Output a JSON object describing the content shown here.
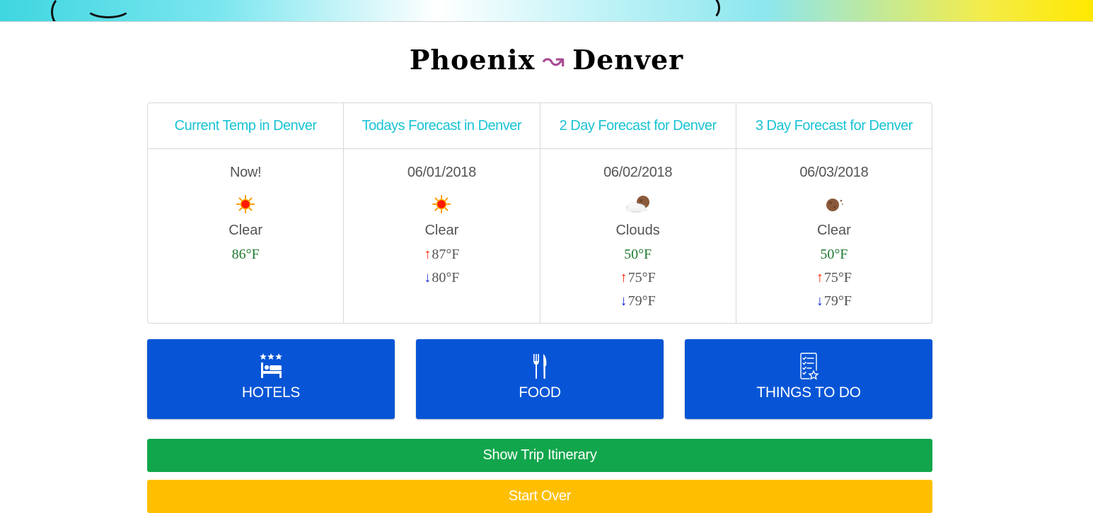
{
  "header": {
    "from_city": "Phoenix",
    "arrow": "↝",
    "to_city": "Denver"
  },
  "forecast": [
    {
      "heading": "Current Temp in Denver",
      "label": "Now!",
      "icon": "sun-icon",
      "condition": "Clear",
      "temp": "86°F"
    },
    {
      "heading": "Todays Forecast in Denver",
      "label": "06/01/2018",
      "icon": "sun-icon",
      "condition": "Clear",
      "high": "87°F",
      "low": "80°F"
    },
    {
      "heading": "2 Day Forecast for Denver",
      "label": "06/02/2018",
      "icon": "moon-cloud-icon",
      "condition": "Clouds",
      "temp": "50°F",
      "high": "75°F",
      "low": "79°F"
    },
    {
      "heading": "3 Day Forecast for Denver",
      "label": "06/03/2018",
      "icon": "moon-icon",
      "condition": "Clear",
      "temp": "50°F",
      "high": "75°F",
      "low": "79°F"
    }
  ],
  "up_arrow": "↑",
  "down_arrow": "↓",
  "categories": [
    {
      "label": "HOTELS",
      "icon": "hotel-icon"
    },
    {
      "label": "FOOD",
      "icon": "fork-knife-icon"
    },
    {
      "label": "THINGS TO DO",
      "icon": "checklist-icon"
    }
  ],
  "actions": {
    "itinerary": "Show Trip Itinerary",
    "start_over": "Start Over"
  },
  "colors": {
    "heading": "#19c3d4",
    "category_button": "#0755d6",
    "itinerary_button": "#12a64c",
    "start_over_button": "#ffbf00",
    "current_temp": "#1f7a30",
    "high_arrow": "#ff1f00",
    "low_arrow": "#1a2cd6"
  }
}
